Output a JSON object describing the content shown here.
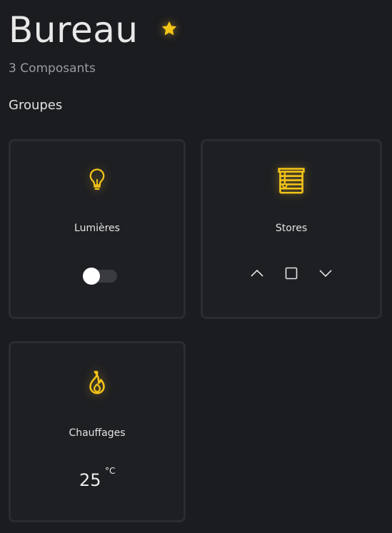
{
  "header": {
    "title": "Bureau",
    "favorite_icon": "star-icon",
    "subtitle": "3 Composants"
  },
  "section": {
    "title": "Groupes"
  },
  "accent_color": "#f5c518",
  "groups": [
    {
      "label": "Lumières",
      "icon": "lightbulb-icon",
      "control": "toggle",
      "toggle_on": false
    },
    {
      "label": "Stores",
      "icon": "blinds-icon",
      "control": "blind-controls",
      "buttons": [
        "chevron-up-icon",
        "stop-square-icon",
        "chevron-down-icon"
      ]
    },
    {
      "label": "Chauffages",
      "icon": "flame-icon",
      "control": "temperature",
      "temperature": "25",
      "unit": "°C"
    }
  ]
}
